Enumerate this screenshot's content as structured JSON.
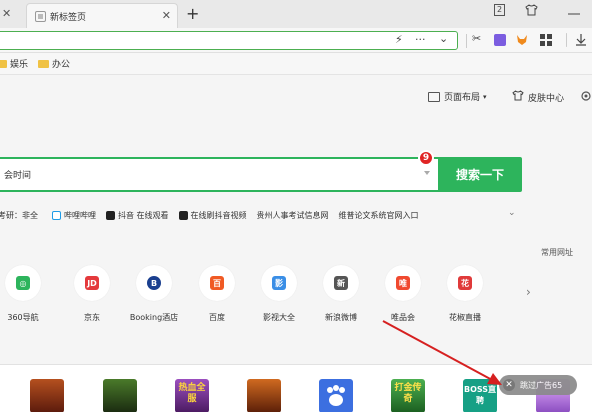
{
  "tab": {
    "title": "新标签页",
    "close": "✕",
    "new_tab": "+"
  },
  "window": {
    "left_close": "✕",
    "icons": [
      "2",
      "shirt-icon",
      "minimize-icon"
    ]
  },
  "address": {
    "value": "",
    "actions": [
      "⚡",
      "···",
      "⌄",
      "✂"
    ]
  },
  "bookmarks": [
    {
      "label": "娱乐"
    },
    {
      "label": "办公"
    }
  ],
  "page_tools": {
    "layout": "页面布局",
    "skin": "皮肤中心"
  },
  "search": {
    "query": "会时间",
    "button": "搜索一下",
    "badge": "9"
  },
  "hotwords": [
    {
      "text": "考研：非全",
      "color": ""
    },
    {
      "text": "哔哩哔哩",
      "color": "#1e9be6"
    },
    {
      "text": "抖音 在线观看",
      "color": "#222222"
    },
    {
      "text": "在线刷抖音视频",
      "color": "#222222"
    },
    {
      "text": "贵州人事考试信息网",
      "color": ""
    },
    {
      "text": "维普论文系统官网入口",
      "color": ""
    }
  ],
  "common_sites": "常用网址",
  "tiles": [
    {
      "label": "360导航",
      "glyph": "◎",
      "color": "#2db45c"
    },
    {
      "label": "京东",
      "glyph": "JD",
      "color": "#e4393c"
    },
    {
      "label": "Booking酒店",
      "glyph": "B",
      "color": "#1a3f8f"
    },
    {
      "label": "百度",
      "glyph": "百",
      "color": "#f05a24"
    },
    {
      "label": "影视大全",
      "glyph": "影",
      "color": "#3a8ee6"
    },
    {
      "label": "新浪微博",
      "glyph": "新",
      "color": "#555555"
    },
    {
      "label": "唯品会",
      "glyph": "唯",
      "color": "#f0492f"
    },
    {
      "label": "花椒直播",
      "glyph": "花",
      "color": "#e03a3a"
    }
  ],
  "games": [
    {
      "name": "game-1",
      "text": "",
      "color": "#7a2b16"
    },
    {
      "name": "game-2",
      "text": "",
      "color": "#2a4a1a"
    },
    {
      "name": "game-3",
      "text": "热血全服",
      "color": "#6b2d8a"
    },
    {
      "name": "game-4",
      "text": "",
      "color": "#8a3b12"
    },
    {
      "name": "game-5-baidu",
      "text": "",
      "color": "#3c6fe0"
    },
    {
      "name": "game-6",
      "text": "打金传奇",
      "color": "#2b8a3e"
    },
    {
      "name": "game-7-boss",
      "text": "BOSS直聘",
      "color": "#16a085"
    }
  ],
  "skip_ad": {
    "label": "跳过广告65",
    "close": "✕"
  },
  "colors": {
    "accent": "#2db45c",
    "badge": "#e02424",
    "arrow": "#d62020"
  }
}
